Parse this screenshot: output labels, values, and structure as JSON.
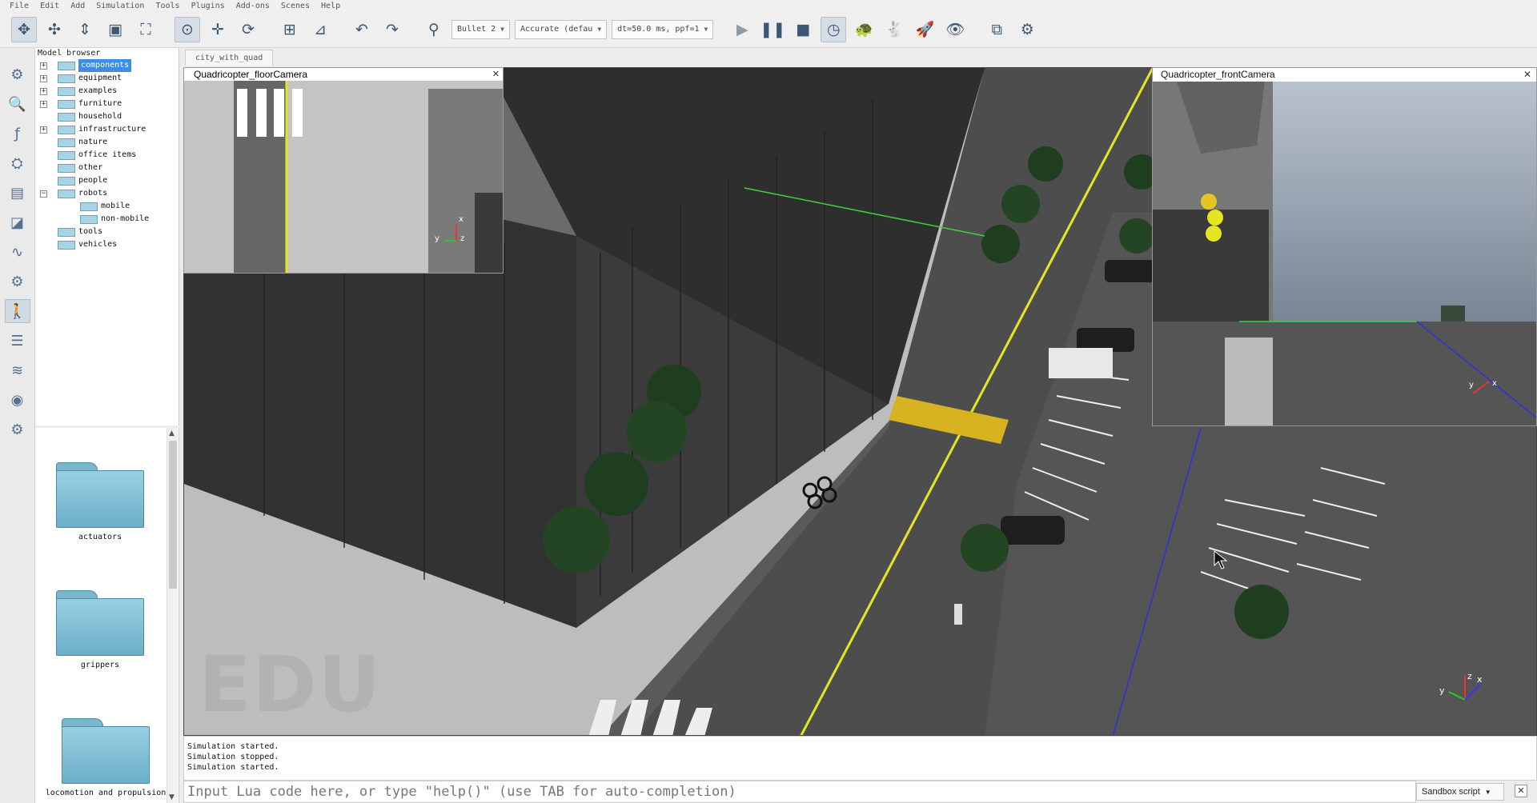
{
  "menu": [
    "File",
    "Edit",
    "Add",
    "Simulation",
    "Tools",
    "Plugins",
    "Add-ons",
    "Scenes",
    "Help"
  ],
  "toolbar": {
    "engine": "Bullet 2",
    "accuracy": "Accurate (defau",
    "timestep": "dt=50.0 ms, ppf=1"
  },
  "model_browser": {
    "title": "Model browser",
    "items": [
      {
        "label": "components",
        "expandable": true,
        "selected": true
      },
      {
        "label": "equipment",
        "expandable": true
      },
      {
        "label": "examples",
        "expandable": true
      },
      {
        "label": "furniture",
        "expandable": true
      },
      {
        "label": "household",
        "expandable": false
      },
      {
        "label": "infrastructure",
        "expandable": true
      },
      {
        "label": "nature",
        "expandable": false
      },
      {
        "label": "office items",
        "expandable": false
      },
      {
        "label": "other",
        "expandable": false
      },
      {
        "label": "people",
        "expandable": false
      },
      {
        "label": "robots",
        "expandable": true,
        "expanded": true
      },
      {
        "label": "mobile",
        "child": true
      },
      {
        "label": "non-mobile",
        "child": true
      },
      {
        "label": "tools",
        "expandable": false
      },
      {
        "label": "vehicles",
        "expandable": false
      }
    ]
  },
  "thumbnails": [
    "actuators",
    "grippers",
    "locomotion and propulsion"
  ],
  "scene_tab": "city_with_quad",
  "floor_camera": {
    "title": "Quadricopter_floorCamera",
    "axis_x": "x",
    "axis_y": "y",
    "axis_z": "z"
  },
  "front_camera": {
    "title": "Quadricopter_frontCamera",
    "axis_x": "x",
    "axis_y": "y"
  },
  "main_axes": {
    "x": "x",
    "y": "y",
    "z": "z"
  },
  "watermark": "EDU",
  "console": {
    "lines": [
      "Simulation started.",
      "Simulation stopped.",
      "Simulation started."
    ],
    "input_placeholder": "Input Lua code here, or type \"help()\" (use TAB for auto-completion)",
    "script_mode": "Sandbox script"
  }
}
